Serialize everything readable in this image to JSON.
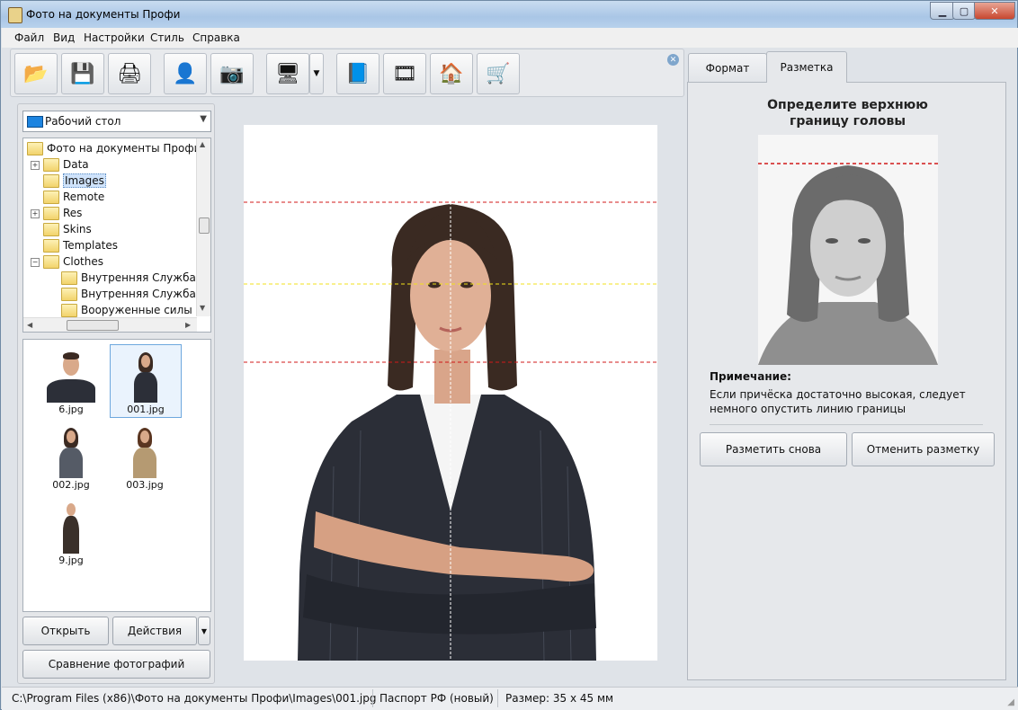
{
  "window": {
    "title": "Фото на документы Профи"
  },
  "menu": [
    "Файл",
    "Вид",
    "Настройки",
    "Стиль",
    "Справка"
  ],
  "toolbar": {
    "buttons": [
      {
        "icon": "open-folder-icon",
        "glyph": "📂"
      },
      {
        "icon": "floppy-disk-icon",
        "glyph": "💾"
      },
      {
        "icon": "printer-icon",
        "glyph": "🖨"
      },
      {
        "icon": "person-icon",
        "glyph": "👤"
      },
      {
        "icon": "camera-icon",
        "glyph": "📷"
      },
      {
        "icon": "monitor-icon",
        "glyph": "🖥"
      },
      {
        "icon": "help-book-icon",
        "glyph": "📘"
      },
      {
        "icon": "film-reel-icon",
        "glyph": "🎞"
      },
      {
        "icon": "home-icon",
        "glyph": "🏠"
      },
      {
        "icon": "shopping-cart-icon",
        "glyph": "🛒"
      }
    ],
    "dropdown_glyph": "▼",
    "close_glyph": "✕"
  },
  "left": {
    "location": "Рабочий стол",
    "tree": [
      {
        "label": "Фото на документы Профи",
        "level": 0,
        "expander": ""
      },
      {
        "label": "Data",
        "level": 1,
        "expander": "+"
      },
      {
        "label": "Images",
        "level": 1,
        "expander": "",
        "selected": true
      },
      {
        "label": "Remote",
        "level": 1,
        "expander": ""
      },
      {
        "label": "Res",
        "level": 1,
        "expander": "+"
      },
      {
        "label": "Skins",
        "level": 1,
        "expander": ""
      },
      {
        "label": "Templates",
        "level": 1,
        "expander": ""
      },
      {
        "label": "Clothes",
        "level": 1,
        "expander": "−"
      },
      {
        "label": "Внутренняя Служба ж",
        "level": 2,
        "expander": ""
      },
      {
        "label": "Внутренняя Служба м",
        "level": 2,
        "expander": ""
      },
      {
        "label": "Вооруженные силы Р(",
        "level": 2,
        "expander": ""
      }
    ],
    "thumbnails": [
      {
        "label": "6.jpg"
      },
      {
        "label": "001.jpg",
        "selected": true
      },
      {
        "label": "002.jpg"
      },
      {
        "label": "003.jpg"
      },
      {
        "label": "9.jpg"
      }
    ],
    "open_label": "Открыть",
    "actions_label": "Действия",
    "actions_drop": "▼",
    "compare_label": "Сравнение фотографий"
  },
  "tabs": {
    "format": "Формат",
    "markup": "Разметка"
  },
  "right": {
    "title_line1": "Определите верхнюю",
    "title_line2": "границу головы",
    "note_title": "Примечание:",
    "note_text": "Если причёска достаточно высокая, следует немного опустить линию границы",
    "remark_again": "Разметить снова",
    "cancel_markup": "Отменить разметку"
  },
  "status": {
    "path": "C:\\Program Files (x86)\\Фото на документы Профи\\Images\\001.jpg",
    "format": "Паспорт РФ (новый)",
    "size": "Размер: 35 x 45 мм"
  },
  "colors": {
    "guide_red": "#d01818",
    "guide_yellow": "#f2e21b",
    "accent": "#1c84e0"
  }
}
